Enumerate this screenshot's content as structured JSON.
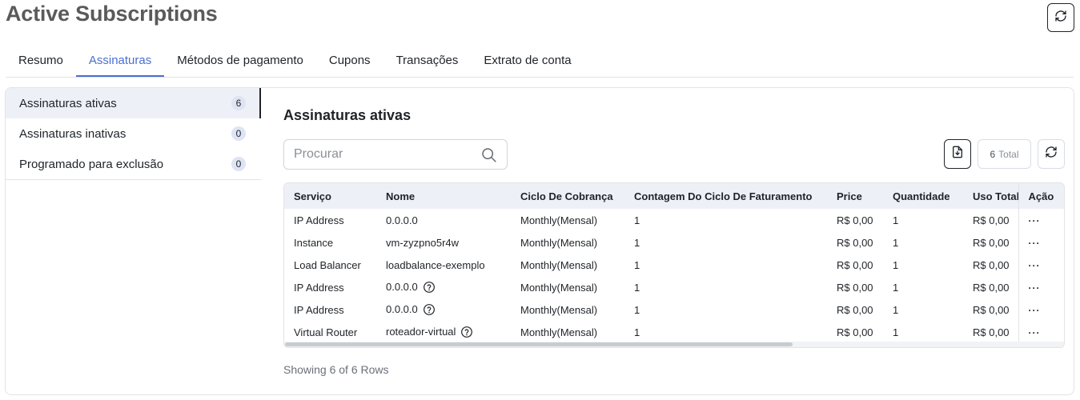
{
  "page": {
    "title": "Active Subscriptions"
  },
  "tabs": [
    {
      "label": "Resumo"
    },
    {
      "label": "Assinaturas"
    },
    {
      "label": "Métodos de pagamento"
    },
    {
      "label": "Cupons"
    },
    {
      "label": "Transações"
    },
    {
      "label": "Extrato de conta"
    }
  ],
  "active_tab": "Assinaturas",
  "sidebar": {
    "items": [
      {
        "label": "Assinaturas ativas",
        "count": "6"
      },
      {
        "label": "Assinaturas inativas",
        "count": "0"
      },
      {
        "label": "Programado para exclusão",
        "count": "0"
      }
    ]
  },
  "main": {
    "title": "Assinaturas ativas",
    "search": {
      "placeholder": "Procurar",
      "value": ""
    },
    "total": {
      "count": "6",
      "label": "Total"
    },
    "footer": "Showing 6 of 6 Rows"
  },
  "table": {
    "headers": [
      "Serviço",
      "Nome",
      "Ciclo De Cobrança",
      "Contagem Do Ciclo De Faturamento",
      "Price",
      "Quantidade",
      "Uso Total",
      "Ação"
    ],
    "rows": [
      {
        "servico": "IP Address",
        "nome": "0.0.0.0",
        "ciclo": "Monthly(Mensal)",
        "contagem": "1",
        "price": "R$ 0,00",
        "quantidade": "1",
        "uso": "R$ 0,00",
        "acao": "···",
        "help": false
      },
      {
        "servico": "Instance",
        "nome": "vm-zyzpno5r4w",
        "ciclo": "Monthly(Mensal)",
        "contagem": "1",
        "price": "R$ 0,00",
        "quantidade": "1",
        "uso": "R$ 0,00",
        "acao": "···",
        "help": false
      },
      {
        "servico": "Load Balancer",
        "nome": "loadbalance-exemplo",
        "ciclo": "Monthly(Mensal)",
        "contagem": "1",
        "price": "R$ 0,00",
        "quantidade": "1",
        "uso": "R$ 0,00",
        "acao": "···",
        "help": false
      },
      {
        "servico": "IP Address",
        "nome": "0.0.0.0",
        "ciclo": "Monthly(Mensal)",
        "contagem": "1",
        "price": "R$ 0,00",
        "quantidade": "1",
        "uso": "R$ 0,00",
        "acao": "···",
        "help": true
      },
      {
        "servico": "IP Address",
        "nome": "0.0.0.0",
        "ciclo": "Monthly(Mensal)",
        "contagem": "1",
        "price": "R$ 0,00",
        "quantidade": "1",
        "uso": "R$ 0,00",
        "acao": "···",
        "help": true
      },
      {
        "servico": "Virtual Router",
        "nome": "roteador-virtual",
        "ciclo": "Monthly(Mensal)",
        "contagem": "1",
        "price": "R$ 0,00",
        "quantidade": "1",
        "uso": "R$ 0,00",
        "acao": "···",
        "help": true
      }
    ]
  },
  "icons": {
    "refresh": "refresh-icon",
    "search": "search-icon",
    "export": "file-download-icon",
    "help": "help-circle-icon",
    "more": "more-horizontal-icon"
  },
  "colors": {
    "accent": "#4a6fd1",
    "title": "#5a5a5a",
    "header_bg": "#eef0f7",
    "badge_bg": "#dfe4f4"
  }
}
